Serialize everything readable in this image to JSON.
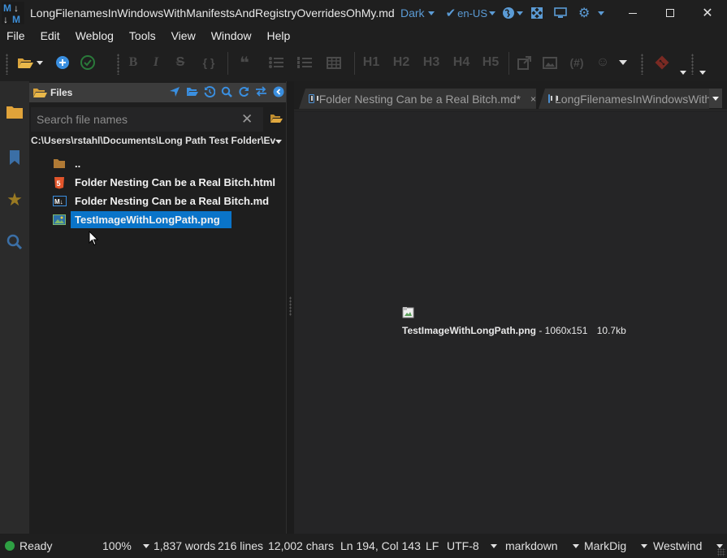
{
  "window": {
    "title": "LongFilenamesInWindowsWithManifestsAndRegistryOverridesOhMy.md  -...",
    "theme": "Dark",
    "language": "en-US"
  },
  "menu": [
    "File",
    "Edit",
    "Weblog",
    "Tools",
    "View",
    "Window",
    "Help"
  ],
  "toolbar": {
    "headings": [
      "H1",
      "H2",
      "H3",
      "H4",
      "H5"
    ],
    "bold": "B",
    "italic": "I",
    "strike": "S",
    "code": "{ }",
    "heading_hash": "(#)"
  },
  "file_pane": {
    "title": "Files",
    "search_placeholder": "Search file names",
    "path": "C:\\Users\\rstahl\\Documents\\Long Path Test Folder\\Ev",
    "files": [
      {
        "name": "..",
        "icon": "folder-icon",
        "selected": false
      },
      {
        "name": "Folder Nesting Can be a Real Bitch.html",
        "icon": "html5-icon",
        "selected": false
      },
      {
        "name": "Folder Nesting Can be a Real Bitch.md",
        "icon": "markdown-icon",
        "selected": false
      },
      {
        "name": "TestImageWithLongPath.png",
        "icon": "image-icon",
        "selected": true
      }
    ]
  },
  "tabs": [
    {
      "label": "Folder Nesting Can be a Real Bitch.md*",
      "close": "×",
      "active": false
    },
    {
      "label": "LongFilenamesInWindowsWith",
      "active": false
    }
  ],
  "preview": {
    "image_name": "TestImageWithLongPath.png",
    "separator": " - ",
    "dimensions": "1060x151",
    "size": "10.7kb"
  },
  "status": {
    "ready": "Ready",
    "zoom": "100%",
    "words": "1,837 words",
    "lines": "216 lines",
    "chars": "12,002 chars",
    "position": "Ln 194, Col 143",
    "line_ending": "LF",
    "encoding": "UTF-8",
    "syntax": "markdown",
    "parser": "MarkDig",
    "preview_theme": "Westwind"
  },
  "colors": {
    "accent": "#0a74c9",
    "theme_text": "#5b9bd5",
    "ready_dot": "#2ea043",
    "folder": "#d8a23b"
  }
}
